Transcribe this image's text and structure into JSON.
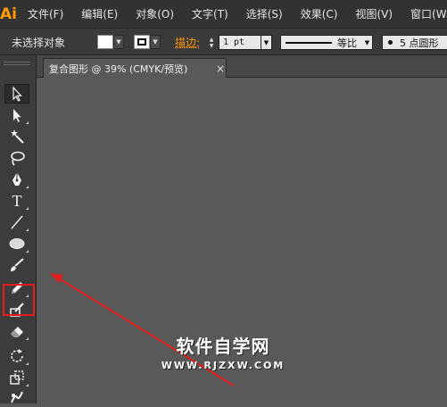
{
  "app": {
    "logo": "Ai"
  },
  "menu": [
    {
      "label": "文件(F)"
    },
    {
      "label": "编辑(E)"
    },
    {
      "label": "对象(O)"
    },
    {
      "label": "文字(T)"
    },
    {
      "label": "选择(S)"
    },
    {
      "label": "效果(C)"
    },
    {
      "label": "视图(V)"
    },
    {
      "label": "窗口(W)"
    }
  ],
  "control": {
    "selection_status": "未选择对象",
    "fill_color": "#ffffff",
    "stroke_label": "描边:",
    "stroke_weight": "1 pt",
    "profile_label": "等比",
    "brush_label": "5 点圆形"
  },
  "document": {
    "tab_title": "复合图形 @ 39% (CMYK/预览)",
    "close_symbol": "×"
  },
  "tools": [
    {
      "name": "selection-tool",
      "icon": "selection-arrow-icon",
      "selected": true
    },
    {
      "name": "direct-selection-tool",
      "icon": "direct-selection-icon"
    },
    {
      "name": "magic-wand-tool",
      "icon": "magic-wand-icon"
    },
    {
      "name": "lasso-tool",
      "icon": "lasso-icon"
    },
    {
      "name": "pen-tool",
      "icon": "pen-icon"
    },
    {
      "name": "type-tool",
      "icon": "type-icon",
      "glyph": "T"
    },
    {
      "name": "line-segment-tool",
      "icon": "line-icon"
    },
    {
      "name": "ellipse-tool",
      "icon": "ellipse-icon",
      "highlighted": true
    },
    {
      "name": "paintbrush-tool",
      "icon": "paintbrush-icon"
    },
    {
      "name": "pencil-tool",
      "icon": "pencil-icon"
    },
    {
      "name": "blob-brush-tool",
      "icon": "blob-brush-icon"
    },
    {
      "name": "eraser-tool",
      "icon": "eraser-icon"
    },
    {
      "name": "rotate-tool",
      "icon": "rotate-icon"
    },
    {
      "name": "scale-tool",
      "icon": "scale-icon"
    },
    {
      "name": "puppet-warp-tool",
      "icon": "warp-icon"
    }
  ],
  "annotation": {
    "highlight_color": "#e11d1d",
    "arrow_color": "#e11d1d"
  },
  "watermark": {
    "main": "软件自学网",
    "sub": "WWW.RJZXW.COM"
  }
}
